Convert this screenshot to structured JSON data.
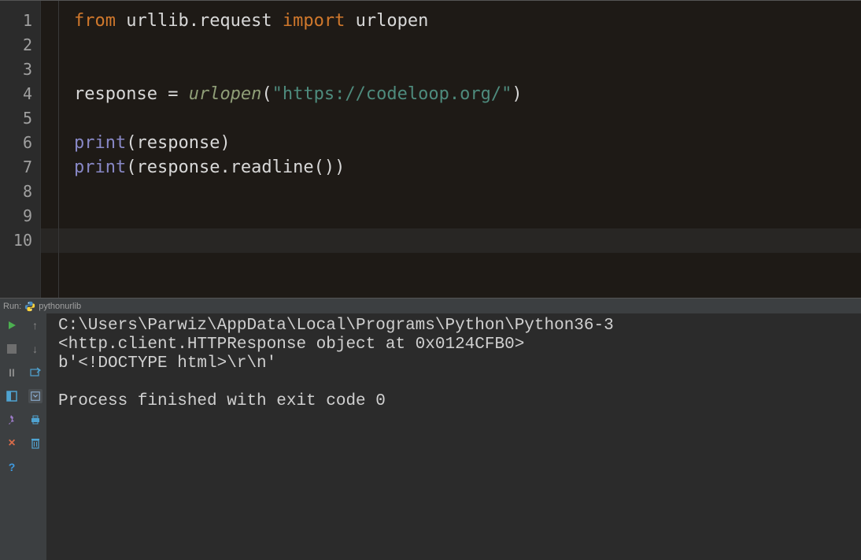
{
  "editor": {
    "line_numbers": [
      "1",
      "2",
      "3",
      "4",
      "5",
      "6",
      "7",
      "8",
      "9",
      "10"
    ],
    "code": {
      "l1": {
        "from": "from",
        "mod": " urllib.request ",
        "import": "import",
        "name": " urlopen"
      },
      "l4": {
        "var": "response = ",
        "fn": "urlopen",
        "paren_open": "(",
        "str": "\"https://codeloop.org/\"",
        "paren_close": ")"
      },
      "l6": {
        "fn": "print",
        "args": "(response)"
      },
      "l7": {
        "fn": "print",
        "args": "(response.readline())"
      }
    }
  },
  "run_tab": {
    "label_run": "Run:",
    "config_name": "pythonurlib"
  },
  "console": {
    "line1": "C:\\Users\\Parwiz\\AppData\\Local\\Programs\\Python\\Python36-3",
    "line2": "<http.client.HTTPResponse object at 0x0124CFB0>",
    "line3": "b'<!DOCTYPE html>\\r\\n'",
    "line4": "",
    "line5": "Process finished with exit code 0"
  },
  "icons": {
    "play": "play-icon",
    "stop": "stop-icon",
    "pause": "pause-icon",
    "layout": "layout-icon",
    "pin": "pin-icon",
    "close": "close-icon",
    "help": "help-icon",
    "up": "up-arrow-icon",
    "down": "down-arrow-icon",
    "restore": "restore-icon",
    "target": "target-icon",
    "print": "print-icon",
    "trash": "trash-icon"
  }
}
